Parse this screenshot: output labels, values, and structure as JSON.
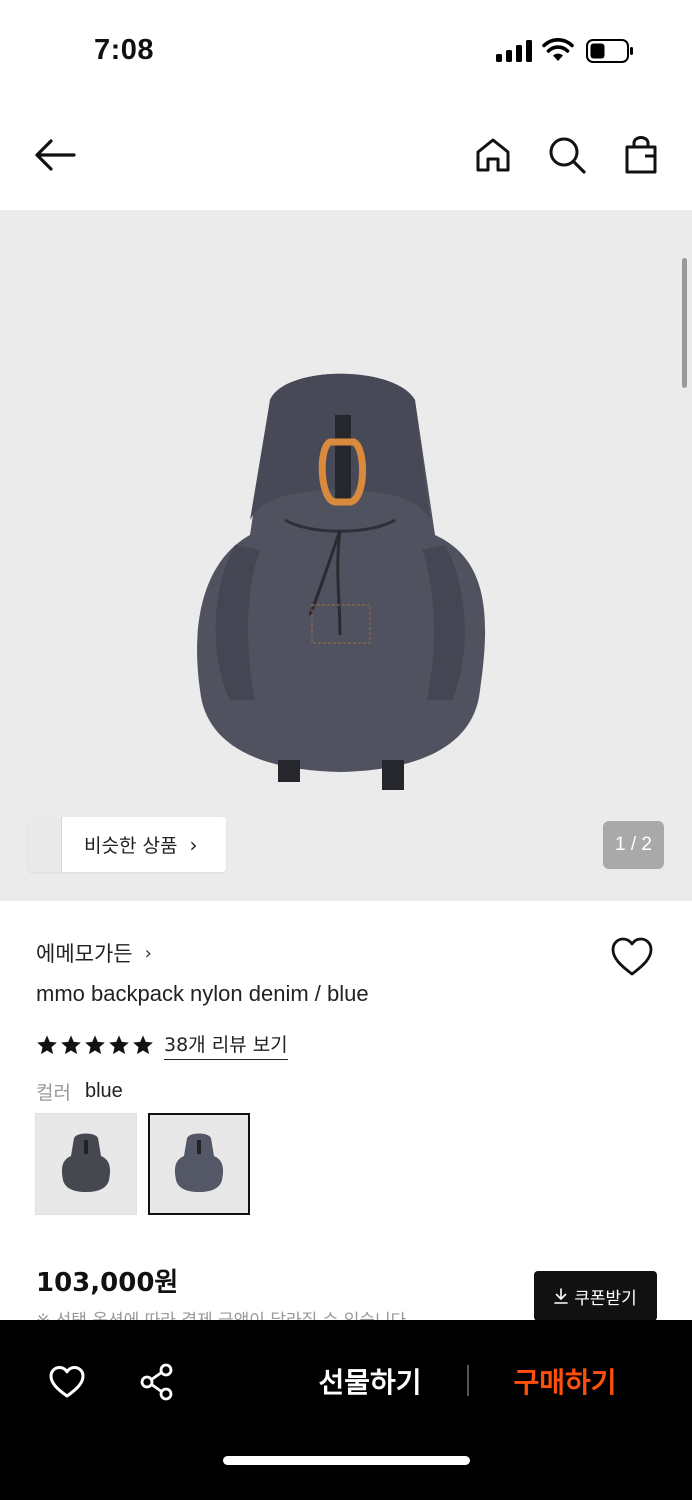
{
  "status_bar": {
    "time": "7:08"
  },
  "header": {
    "icons": [
      "back-arrow-icon",
      "home-icon",
      "search-icon",
      "shopping-bag-icon"
    ]
  },
  "image_area": {
    "similar_label": "비슷한 상품",
    "counter": "1 / 2"
  },
  "product": {
    "brand": "에메모가든",
    "name": "mmo backpack nylon denim / blue",
    "rating_stars": 5,
    "review_link": "38개 리뷰 보기",
    "color_key": "컬러",
    "color_value": "blue",
    "price": "103,000원",
    "coupon_label": "쿠폰받기",
    "notice": "※ 선택 옵션에 따라 결제 금액이 달라질 수 있습니다"
  },
  "bottom_bar": {
    "gift_label": "선물하기",
    "buy_label": "구매하기",
    "buy_color": "#ff4f0a"
  }
}
